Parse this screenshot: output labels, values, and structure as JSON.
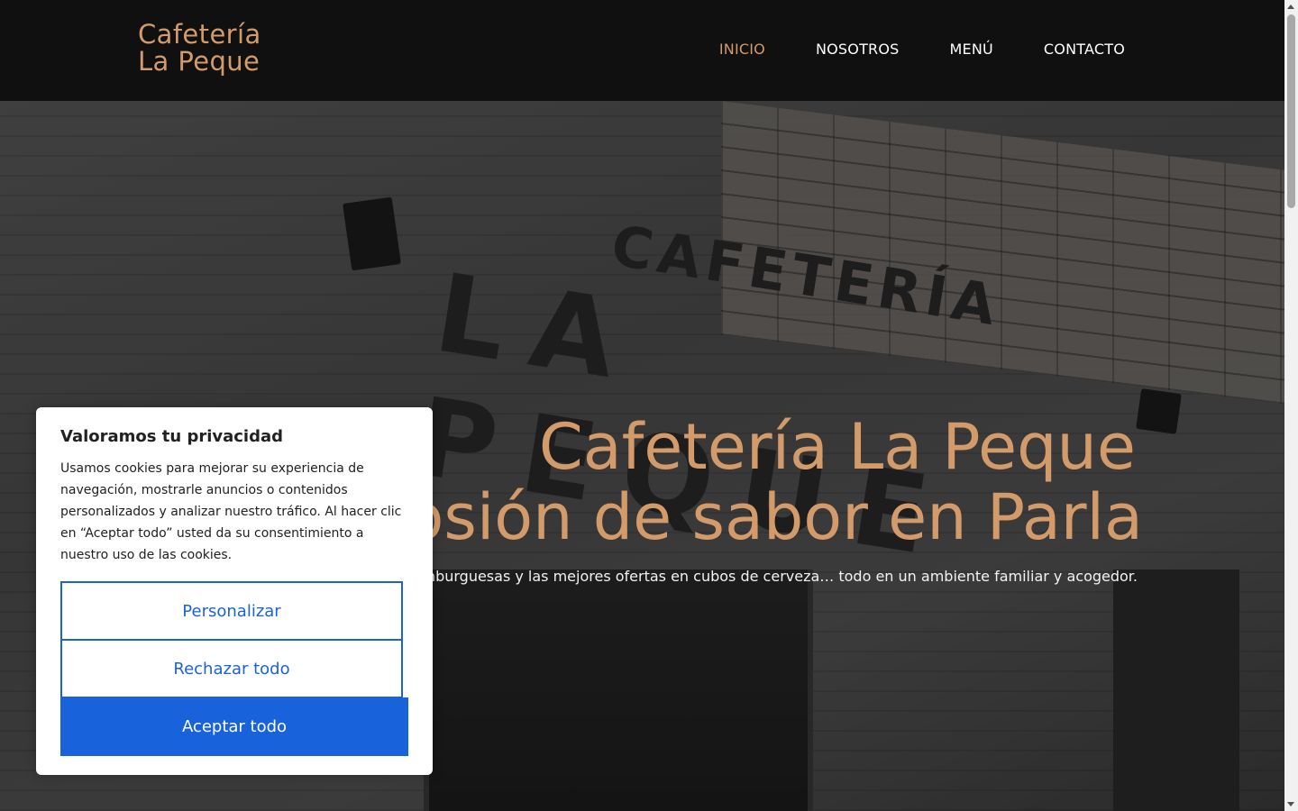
{
  "brand": {
    "line1": "Cafetería",
    "line2": "La Peque"
  },
  "nav": {
    "items": [
      {
        "label": "INICIO",
        "active": true
      },
      {
        "label": "NOSOTROS",
        "active": false
      },
      {
        "label": "MENÚ",
        "active": false
      },
      {
        "label": "CONTACTO",
        "active": false
      }
    ]
  },
  "hero": {
    "title_line1": "Cafetería La Peque",
    "title_line2": "Explosión de sabor en Parla",
    "subtitle": "Hamburguesas y las mejores ofertas en cubos de cerveza… todo en un ambiente familiar y acogedor.",
    "image_sign_line1": "CAFETERÍA",
    "image_sign_line2": "LA PEQUE"
  },
  "cookie_banner": {
    "title": "Valoramos tu privacidad",
    "text": "Usamos cookies para mejorar su experiencia de navegación, mostrarle anuncios o contenidos personalizados y analizar nuestro tráfico. Al hacer clic en “Aceptar todo” usted da su consentimiento a nuestro uso de las cookies.",
    "customize_label": "Personalizar",
    "reject_label": "Rechazar todo",
    "accept_label": "Aceptar todo"
  },
  "colors": {
    "accent": "#d39a6a",
    "navbar_bg": "#111010",
    "primary_button": "#1863dc"
  }
}
